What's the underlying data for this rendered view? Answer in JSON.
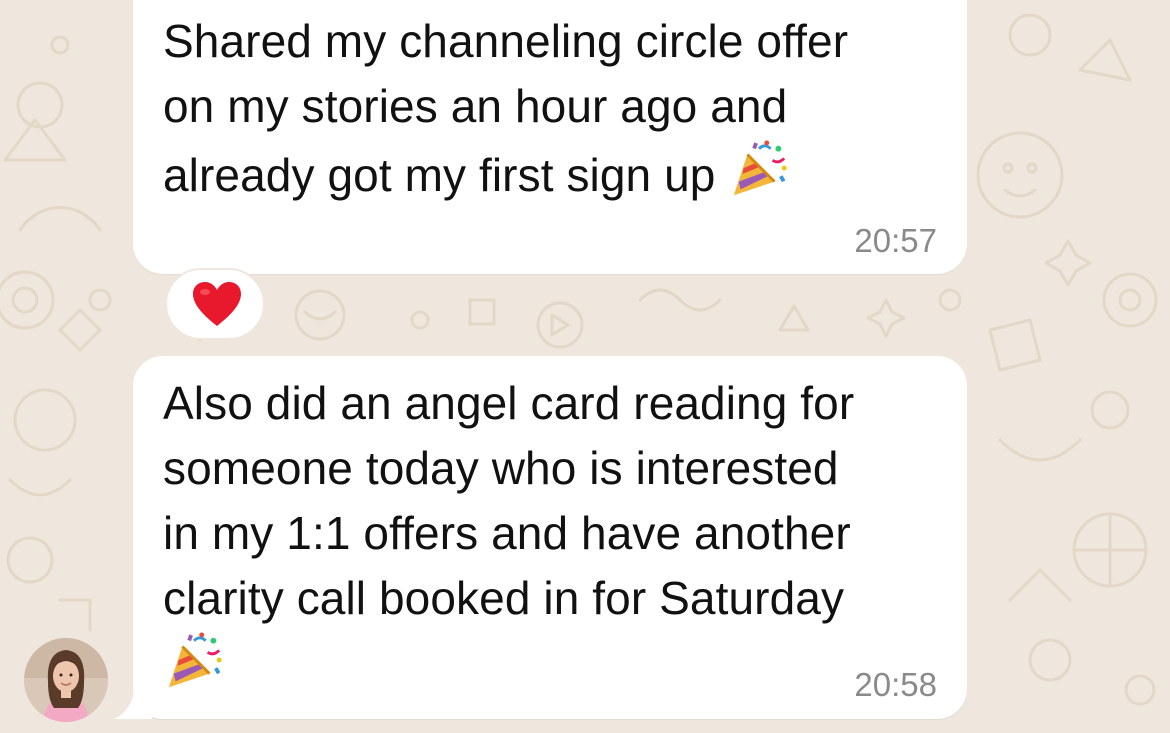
{
  "chat": {
    "messages": [
      {
        "lines": [
          "Shared my channeling circle offer",
          "on my stories an hour ago and",
          "already got my first sign up"
        ],
        "emoji": "party-popper",
        "time": "20:57",
        "reaction": "red-heart"
      },
      {
        "lines": [
          "Also did an angel card reading for",
          "someone today who is interested",
          "in my 1:1 offers and have another",
          "clarity call booked in for Saturday"
        ],
        "emoji": "party-popper",
        "time": "20:58"
      }
    ],
    "sender": {
      "avatar": "user-avatar"
    }
  },
  "colors": {
    "wallpaper": "#efe7dd",
    "doodle": "#e3d8c8",
    "bubble": "#ffffff",
    "text": "#111111",
    "timestamp": "#8a8a8a",
    "heart": "#e8192c"
  }
}
